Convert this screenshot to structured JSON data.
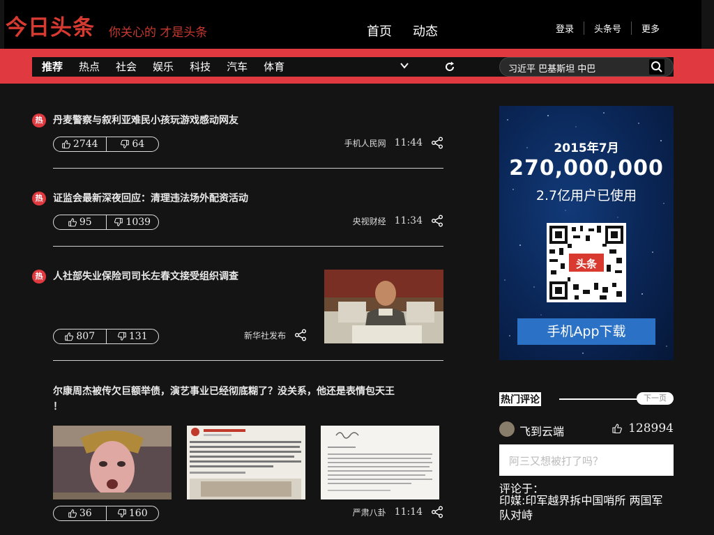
{
  "header": {
    "logo": "今日头条",
    "slogan": "你关心的 才是头条",
    "nav": [
      "首页",
      "动态"
    ],
    "links": [
      "登录",
      "头条号",
      "更多"
    ]
  },
  "categories": {
    "items": [
      "推荐",
      "热点",
      "社会",
      "娱乐",
      "科技",
      "汽车",
      "体育"
    ],
    "active": "推荐"
  },
  "search": {
    "value": "习近平 巴基斯坦 中巴"
  },
  "feed": [
    {
      "badge": "热",
      "title": "丹麦警察与叙利亚难民小孩玩游戏感动网友",
      "up": "2744",
      "down": "64",
      "source": "手机人民网",
      "time": "11:44"
    },
    {
      "badge": "热",
      "title": "证监会最新深夜回应：清理违法场外配资活动",
      "up": "95",
      "down": "1039",
      "source": "央视财经",
      "time": "11:34"
    },
    {
      "badge": "热",
      "title": "人社部失业保险司司长左春文接受组织调查",
      "up": "807",
      "down": "131",
      "source": "新华社发布",
      "time": ""
    },
    {
      "badge": "",
      "title": "尔康周杰被传欠巨额举债，演艺事业已经彻底糊了？没关系，他还是表情包天王",
      "title2": "！",
      "up": "36",
      "down": "160",
      "source": "严肃八卦",
      "time": "11:14"
    }
  ],
  "ad": {
    "year": "2015年7月",
    "big": "270,000,000",
    "users": "2.7亿用户已使用",
    "qr_label": "头条",
    "download": "手机App下载"
  },
  "hot_comments": {
    "title": "热门评论",
    "more": "下一页",
    "user": "飞到云端",
    "likes": "128994",
    "comment": "阿三又想被打了吗？",
    "on_label": "评论于：",
    "link": "印媒:印军越界拆中国哨所 两国军队对峙"
  },
  "colors": {
    "brand_red": "#e0393f",
    "background": "#141414",
    "download_blue": "#2b72c7"
  }
}
